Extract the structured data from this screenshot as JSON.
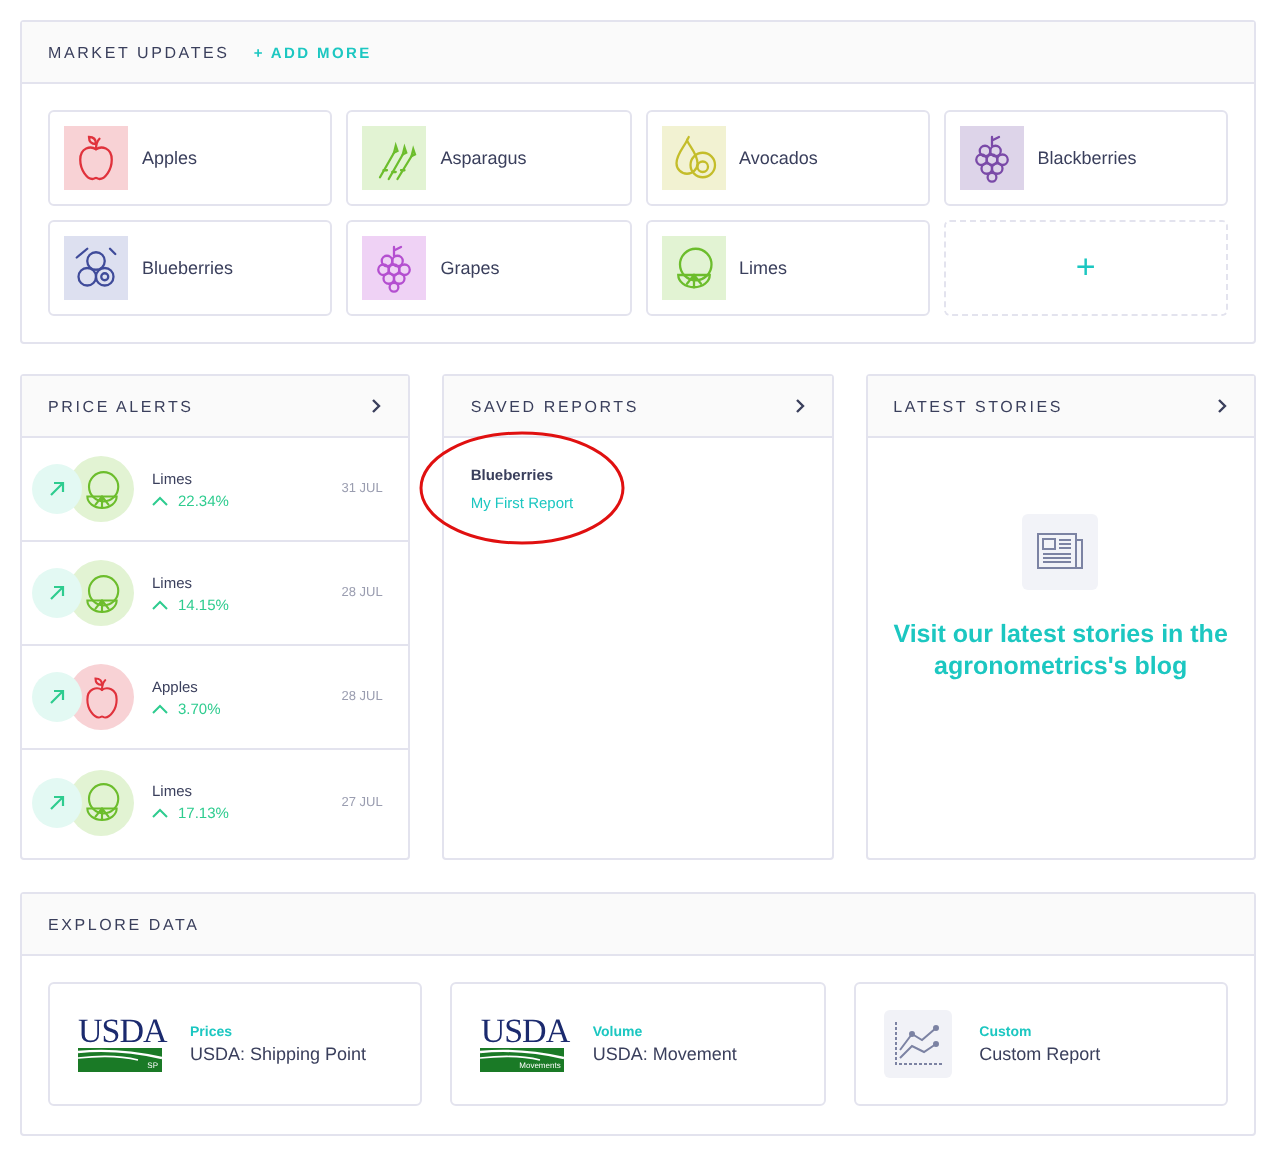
{
  "market_updates": {
    "title": "MARKET UPDATES",
    "add_more": "+ ADD MORE",
    "tiles": [
      {
        "label": "Apples",
        "kind": "apple",
        "color": "#f8d2d5"
      },
      {
        "label": "Asparagus",
        "kind": "asparagus",
        "color": "#e2f3d3"
      },
      {
        "label": "Avocados",
        "kind": "avocado",
        "color": "#f2f2d2"
      },
      {
        "label": "Blackberries",
        "kind": "blackberry",
        "color": "#ddd4e9"
      },
      {
        "label": "Blueberries",
        "kind": "blueberry",
        "color": "#dde0f0"
      },
      {
        "label": "Grapes",
        "kind": "grape",
        "color": "#efd2f5"
      },
      {
        "label": "Limes",
        "kind": "lime",
        "color": "#e2f3d3"
      }
    ],
    "add_tile": "+"
  },
  "price_alerts": {
    "title": "PRICE ALERTS",
    "items": [
      {
        "name": "Limes",
        "change": "22.34%",
        "date": "31 JUL",
        "kind": "lime",
        "color": "#e2f3d3"
      },
      {
        "name": "Limes",
        "change": "14.15%",
        "date": "28 JUL",
        "kind": "lime",
        "color": "#e2f3d3"
      },
      {
        "name": "Apples",
        "change": "3.70%",
        "date": "28 JUL",
        "kind": "apple",
        "color": "#f8d2d5"
      },
      {
        "name": "Limes",
        "change": "17.13%",
        "date": "27 JUL",
        "kind": "lime",
        "color": "#e2f3d3"
      }
    ]
  },
  "saved_reports": {
    "title": "SAVED REPORTS",
    "items": [
      {
        "name": "Blueberries",
        "report": "My First Report",
        "highlighted": true
      }
    ]
  },
  "latest_stories": {
    "title": "LATEST STORIES",
    "message": "Visit our latest stories in the agronometrics's blog"
  },
  "explore_data": {
    "title": "EXPLORE DATA",
    "sources": [
      {
        "kind": "usda",
        "logo_text": "USDA",
        "logo_band": "SP",
        "category": "Prices",
        "name": "USDA: Shipping Point"
      },
      {
        "kind": "usda",
        "logo_text": "USDA",
        "logo_band": "Movements",
        "category": "Volume",
        "name": "USDA: Movement"
      },
      {
        "kind": "custom",
        "category": "Custom",
        "name": "Custom Report"
      }
    ]
  }
}
